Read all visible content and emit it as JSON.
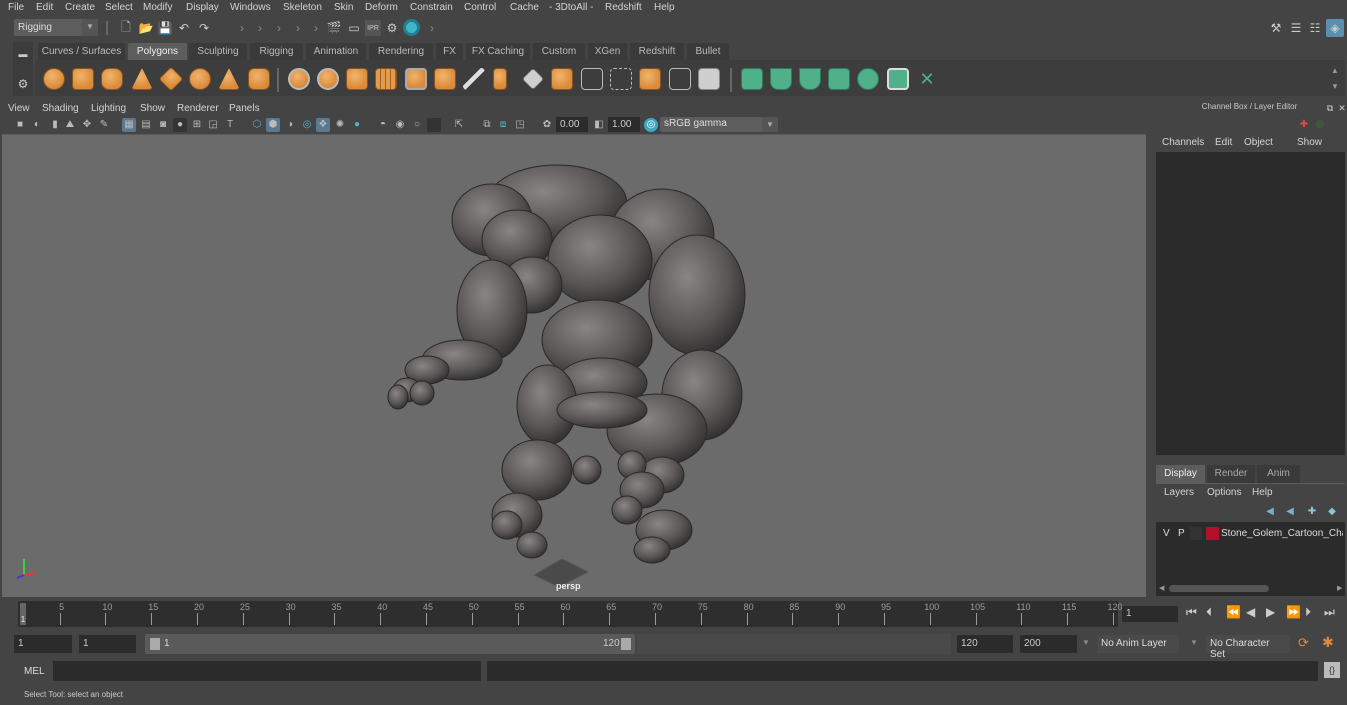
{
  "menubar": {
    "items": [
      "File",
      "Edit",
      "Create",
      "Select",
      "Modify",
      "Display",
      "Windows",
      "Skeleton",
      "Skin",
      "Deform",
      "Constrain",
      "Control",
      "Cache",
      "- 3DtoAll -",
      "Redshift",
      "Help"
    ]
  },
  "statusline": {
    "mode_dropdown": "Rigging",
    "icons": [
      "new-scene",
      "open-scene",
      "save-scene",
      "undo",
      "redo",
      "render-view",
      "render-frame",
      "ipr-render",
      "render-settings",
      "hypershade"
    ]
  },
  "shelf": {
    "tabs": [
      "Curves / Surfaces",
      "Polygons",
      "Sculpting",
      "Rigging",
      "Animation",
      "Rendering",
      "FX",
      "FX Caching",
      "Custom",
      "XGen",
      "Redshift",
      "Bullet"
    ],
    "active_tab": "Polygons",
    "icons": [
      "poly-sphere",
      "poly-cube",
      "poly-cylinder",
      "poly-cone",
      "poly-plane",
      "poly-torus",
      "poly-pyramid",
      "poly-pipe",
      "combine",
      "separate",
      "mirror",
      "smooth",
      "extract",
      "bevel",
      "bridge",
      "multi-cut",
      "extrude",
      "append",
      "fill-hole",
      "insert-edge-loop",
      "offset-edge-loop",
      "poly-cut",
      "boolean",
      "reduce",
      "uv-planar",
      "uv-cylindrical",
      "uv-spherical",
      "uv-automatic",
      "uv-unfold",
      "uv-editor",
      "uv-layout"
    ]
  },
  "panel": {
    "menu": [
      "View",
      "Shading",
      "Lighting",
      "Show",
      "Renderer",
      "Panels"
    ],
    "exposure": "0.00",
    "gamma": "1.00",
    "color_space": "sRGB gamma",
    "camera_label": "persp"
  },
  "channelbox": {
    "title": "Channel Box / Layer Editor",
    "menu": [
      "Channels",
      "Edit",
      "Object",
      "Show"
    ]
  },
  "layereditor": {
    "tabs": [
      "Display",
      "Render",
      "Anim"
    ],
    "active_tab": "Display",
    "menu": [
      "Layers",
      "Options",
      "Help"
    ],
    "layers": [
      {
        "visible": "V",
        "playback": "P",
        "name": "Stone_Golem_Cartoon_Char",
        "color": "#b0102a"
      }
    ]
  },
  "timeline": {
    "ticks": [
      "5",
      "10",
      "15",
      "20",
      "25",
      "30",
      "35",
      "40",
      "45",
      "50",
      "55",
      "60",
      "65",
      "70",
      "75",
      "80",
      "85",
      "90",
      "95",
      "100",
      "105",
      "110",
      "115",
      "120"
    ],
    "current_marker": "1",
    "current_frame": "1",
    "range_start": 1,
    "range_end": 120
  },
  "range": {
    "start_field": "1",
    "playback_start": "1",
    "slider_start": "1",
    "slider_end": "120",
    "playback_end": "120",
    "end_field": "200",
    "anim_layer": "No Anim Layer",
    "character_set": "No Character Set"
  },
  "commandline": {
    "label": "MEL"
  },
  "helpline": {
    "text": "Select Tool: select an object"
  }
}
